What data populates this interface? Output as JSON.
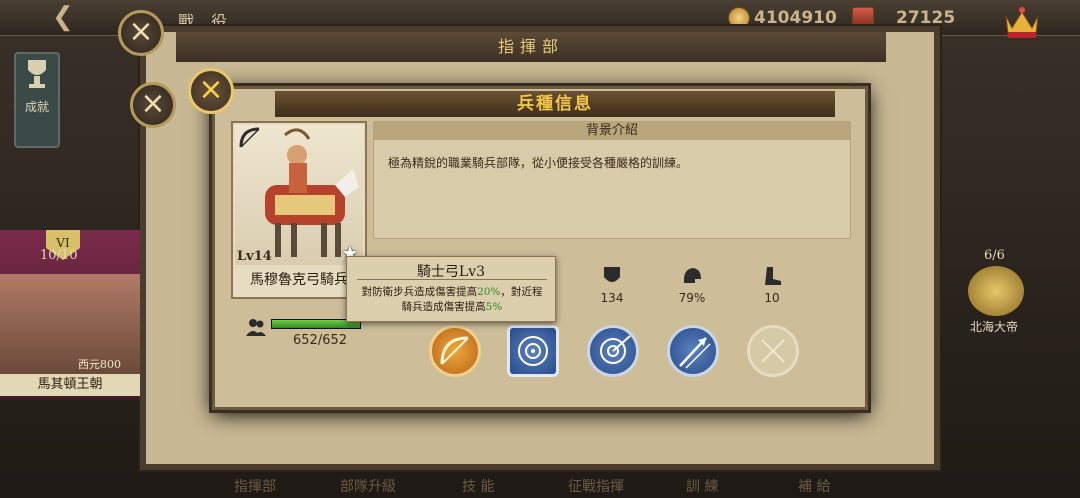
{
  "topbar": {
    "title": "戰 役",
    "currency1": "4104910",
    "currency2": "27125"
  },
  "sidebar": {
    "achievement_label": "成就"
  },
  "panel": {
    "title": "指揮部"
  },
  "left_strip": {
    "count": "10/10",
    "shield": "VI",
    "unit_sub": "西元800",
    "name": "馬其頓王朝"
  },
  "right_strip": {
    "count": "6/6",
    "name": "北海大帝"
  },
  "bottom_nav": [
    "指揮部",
    "部隊升級",
    "技 能",
    "征戰指揮",
    "訓 練",
    "補 給"
  ],
  "modal": {
    "title": "兵種信息",
    "unit": {
      "level": "Lv14",
      "name": "馬穆魯克弓騎兵",
      "hp": "652/652",
      "hp_fraction": 1.0
    },
    "background": {
      "header": "背景介紹",
      "text": "極為精銳的職業騎兵部隊，從小便接受各種嚴格的訓練。"
    },
    "stats": [
      {
        "icon": "shield-icon",
        "value": "134"
      },
      {
        "icon": "helmet-icon",
        "value": "79%"
      },
      {
        "icon": "boot-icon",
        "value": "10"
      }
    ],
    "tooltip": {
      "title": "騎士弓Lv3",
      "line1_pre": "對防衛步兵造成傷害提高",
      "line1_pct": "20%",
      "line1_post": "，對近程",
      "line2_pre": "騎兵造成傷害提高",
      "line2_pct": "5%"
    }
  },
  "colors": {
    "gold": "#f2c64a",
    "green": "#2f8a22",
    "skill_blue": "#3a63a8",
    "skill_orange": "#e08a22"
  }
}
